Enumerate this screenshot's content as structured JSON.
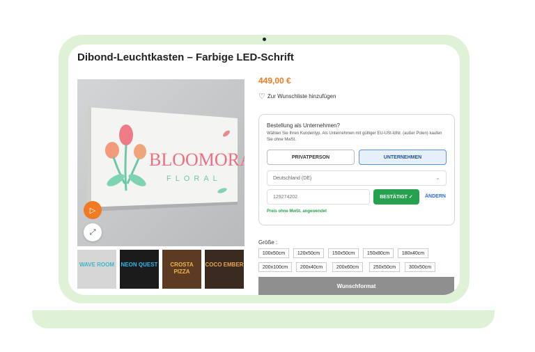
{
  "product": {
    "title": "Dibond-Leuchtkasten – Farbige LED-Schrift",
    "price": "449,00 €",
    "wishlist_label": "Zur Wunschliste hinzufügen"
  },
  "gallery": {
    "sign_text_main": "BLOOMORA",
    "sign_text_sub": "FLORAL",
    "thumbnails": [
      {
        "label": "WAVE ROOM",
        "bg": "#d6d6d6",
        "fg": "#3fb6c7"
      },
      {
        "label": "NEON QUEST",
        "bg": "#1b1b1b",
        "fg": "#2fb8f0"
      },
      {
        "label": "CROSTA PIZZA",
        "bg": "#5c3b22",
        "fg": "#f0b24a"
      },
      {
        "label": "COCO EMBER",
        "bg": "#3a2a1f",
        "fg": "#e8a450"
      }
    ]
  },
  "b2b": {
    "heading": "Bestellung als Unternehmen?",
    "description": "Wählen Sie Ihren Kundentyp. Als Unternehmen mit gültiger EU-USt-IdNr. (außer Polen) kaufen Sie ohne MwSt.",
    "private_label": "PRIVATPERSON",
    "business_label": "UNTERNEHMEN",
    "selected": "UNTERNEHMEN",
    "country": "Deutschland (DE)",
    "vat_number": "129274202",
    "confirm_label": "BESTÄTIGT ✓",
    "change_label": "ÄNDERN",
    "vat_note": "Preis ohne MwSt. angewendet"
  },
  "sizes": {
    "label": "Größe :",
    "options": [
      "100x50cm",
      "120x50cm",
      "150x50cm",
      "150x80cm",
      "180x40cm",
      "200x100cm",
      "200x40cm",
      "200x60cm",
      "250x50cm",
      "300x50cm"
    ]
  },
  "custom_format_label": "Wunschformat",
  "colors": {
    "accent": "#f07b22",
    "confirm": "#27a04f",
    "laptop": "#dff1d6"
  },
  "icons": {
    "play": "play-icon",
    "zoom": "expand-icon",
    "wishlist": "heart-icon",
    "select": "chevron-down-icon"
  }
}
